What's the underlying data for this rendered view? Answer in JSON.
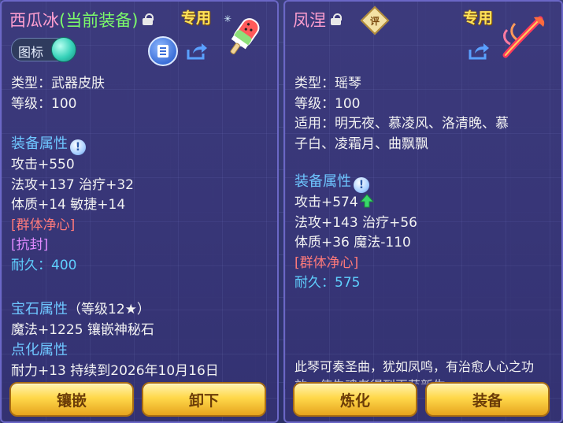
{
  "left": {
    "name": "西瓜冰",
    "name_suffix": "(当前装备)",
    "exclusive": "专用",
    "toggle_label": "图标",
    "rows": [
      {
        "key": "type",
        "text": "类型：武器皮肤"
      },
      {
        "key": "level",
        "text": "等级：100"
      }
    ],
    "equip_attr_title": "装备属性",
    "attrs": [
      "攻击+550",
      "法攻+137 治疗+32",
      "体质+14 敏捷+14"
    ],
    "tags": [
      {
        "text": "[群体净心]",
        "color": "#ff7a7a"
      },
      {
        "text": "[抗封]",
        "color": "#e28bff"
      }
    ],
    "durability_label": "耐久：",
    "durability_value": "400",
    "gem_title": "宝石属性",
    "gem_level": "（等级12★）",
    "gem_line": "魔法+1225 镶嵌神秘石",
    "refine_title": "点化属性",
    "refine_line": "耐力+13 持续到2026年10月16日",
    "buttons": [
      "镶嵌",
      "卸下"
    ]
  },
  "right": {
    "name": "凤涅",
    "eval_badge": "评",
    "exclusive": "专用",
    "rows": [
      {
        "key": "type",
        "text": "类型：瑶琴"
      },
      {
        "key": "level",
        "text": "等级：100"
      },
      {
        "key": "fit1",
        "text": "适用：明无夜、慕凌风、洛清晚、慕"
      },
      {
        "key": "fit2",
        "text": "子白、凌霜月、曲飘飘"
      }
    ],
    "equip_attr_title": "装备属性",
    "attrs": [
      "攻击+574",
      "法攻+143 治疗+56",
      "体质+36 魔法-110"
    ],
    "tag": "[群体净心]",
    "durability_label": "耐久：",
    "durability_value": "575",
    "description": "此琴可奏圣曲，犹如凤鸣，有治愈人心之功效，使失魂者得到再获新生",
    "buttons": [
      "炼化",
      "装备"
    ]
  },
  "colors": {
    "name_pink": "#ff9fd0",
    "suffix_green": "#7cfc6a",
    "section_blue": "#6ec6ff",
    "gold_button": "#ffd84a"
  },
  "icons": [
    "lock-icon",
    "info-icon",
    "share-icon",
    "book-icon",
    "up-arrow-icon",
    "eval-icon"
  ]
}
